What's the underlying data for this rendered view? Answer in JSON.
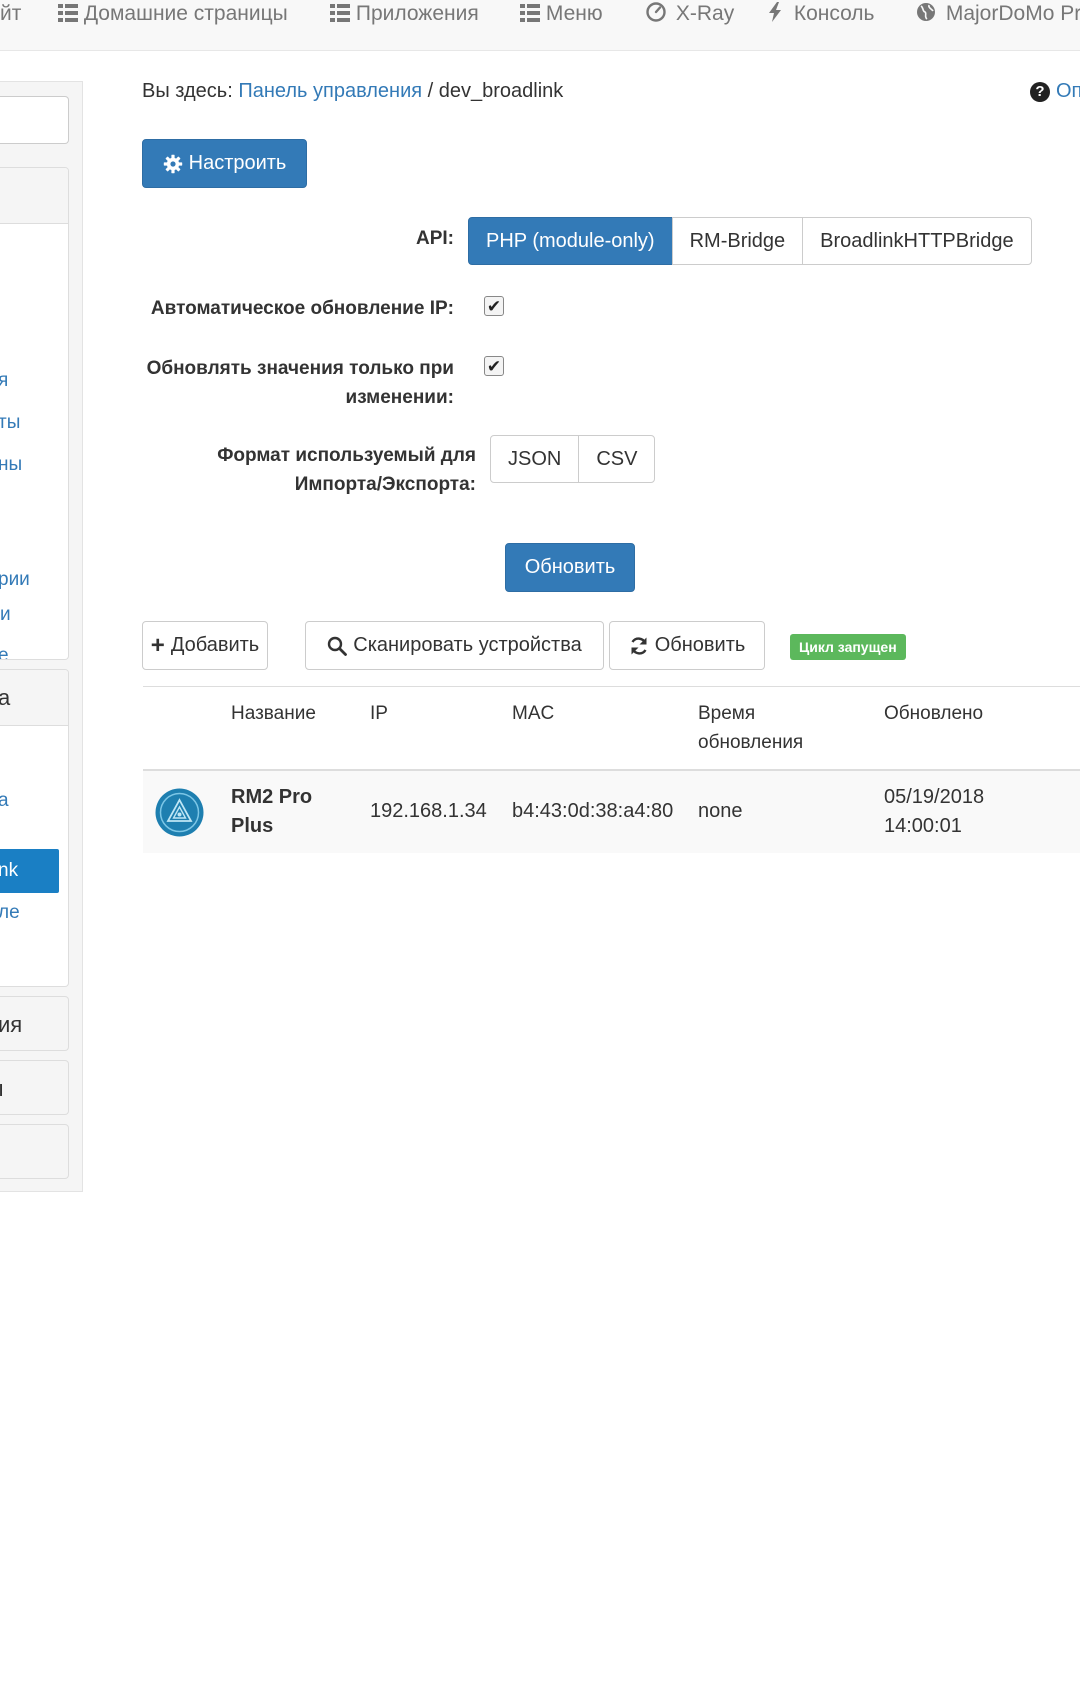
{
  "topnav": {
    "partial_left": "йт",
    "items": [
      {
        "label": "Домашние страницы",
        "icon": "list-icon"
      },
      {
        "label": "Приложения",
        "icon": "list-icon"
      },
      {
        "label": "Меню",
        "icon": "list-icon"
      },
      {
        "label": "X-Ray",
        "icon": "dashboard-icon"
      },
      {
        "label": "Консоль",
        "icon": "bolt-icon"
      },
      {
        "label": "MajorDoMo Pro",
        "icon": "globe-icon"
      }
    ]
  },
  "sidebar": {
    "links_top": [
      "я",
      "ты",
      "ны",
      "рии",
      "е",
      "и"
    ],
    "panel2_head": "а",
    "links_bottom": [
      "а",
      "ле"
    ],
    "active": "nk",
    "collapsed": [
      "ия",
      "ı",
      ""
    ]
  },
  "breadcrumb": {
    "prefix": "Вы здесь:",
    "link": "Панель управления",
    "separator": "/",
    "current": "dev_broadlink"
  },
  "help_label": "Оп",
  "configure_button": "Настроить",
  "form": {
    "api_label": "API:",
    "api_options": [
      "PHP (module-only)",
      "RM-Bridge",
      "BroadlinkHTTPBridge"
    ],
    "api_selected": "PHP (module-only)",
    "auto_ip_label": "Автоматическое обновление IP:",
    "auto_ip_checked": true,
    "update_changed_label_1": "Обновлять значения только при",
    "update_changed_label_2": "изменении:",
    "update_changed_checked": true,
    "format_label_1": "Формат используемый для",
    "format_label_2": "Импорта/Экспорта:",
    "format_options": [
      "JSON",
      "CSV"
    ],
    "update_button": "Обновить"
  },
  "toolbar": {
    "add": "Добавить",
    "scan": "Сканировать устройства",
    "refresh": "Обновить",
    "status_badge": "Цикл запущен"
  },
  "table": {
    "headers": {
      "name": "Название",
      "ip": "IP",
      "mac": "MAC",
      "update_time_1": "Время",
      "update_time_2": "обновления",
      "updated": "Обновлено"
    },
    "rows": [
      {
        "name_1": "RM2 Pro",
        "name_2": "Plus",
        "ip": "192.168.1.34",
        "mac": "b4:43:0d:38:a4:80",
        "update_time": "none",
        "updated_1": "05/19/2018",
        "updated_2": "14:00:01"
      }
    ]
  },
  "colors": {
    "primary": "#337ab7",
    "success": "#5cb85c",
    "nav_bg": "#f8f8f8"
  }
}
